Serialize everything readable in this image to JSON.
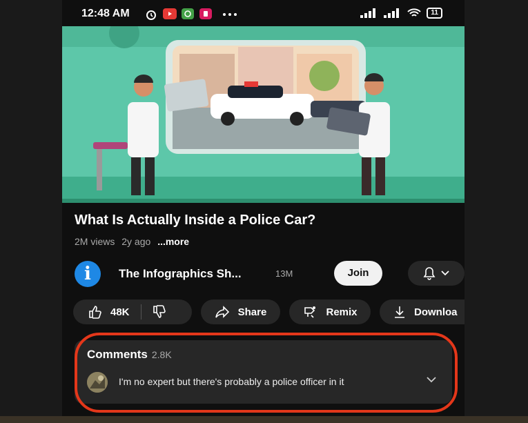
{
  "status_bar": {
    "time": "12:48 AM",
    "battery": "11"
  },
  "video": {
    "title": "What Is Actually Inside a Police Car?",
    "views": "2M views",
    "age": "2y ago",
    "more_label": "...more"
  },
  "channel": {
    "avatar_letter": "i",
    "name": "The Infographics Sh...",
    "subscribers": "13M",
    "join_label": "Join"
  },
  "actions": {
    "likes": "48K",
    "share_label": "Share",
    "remix_label": "Remix",
    "download_label": "Downloa"
  },
  "comments": {
    "header": "Comments",
    "count": "2.8K",
    "top_comment": "I'm no expert but there's probably a police officer in it"
  },
  "colors": {
    "background": "#0f0f0f",
    "pill": "#272727",
    "highlight": "#e4371a",
    "avatar": "#1e88e5"
  }
}
